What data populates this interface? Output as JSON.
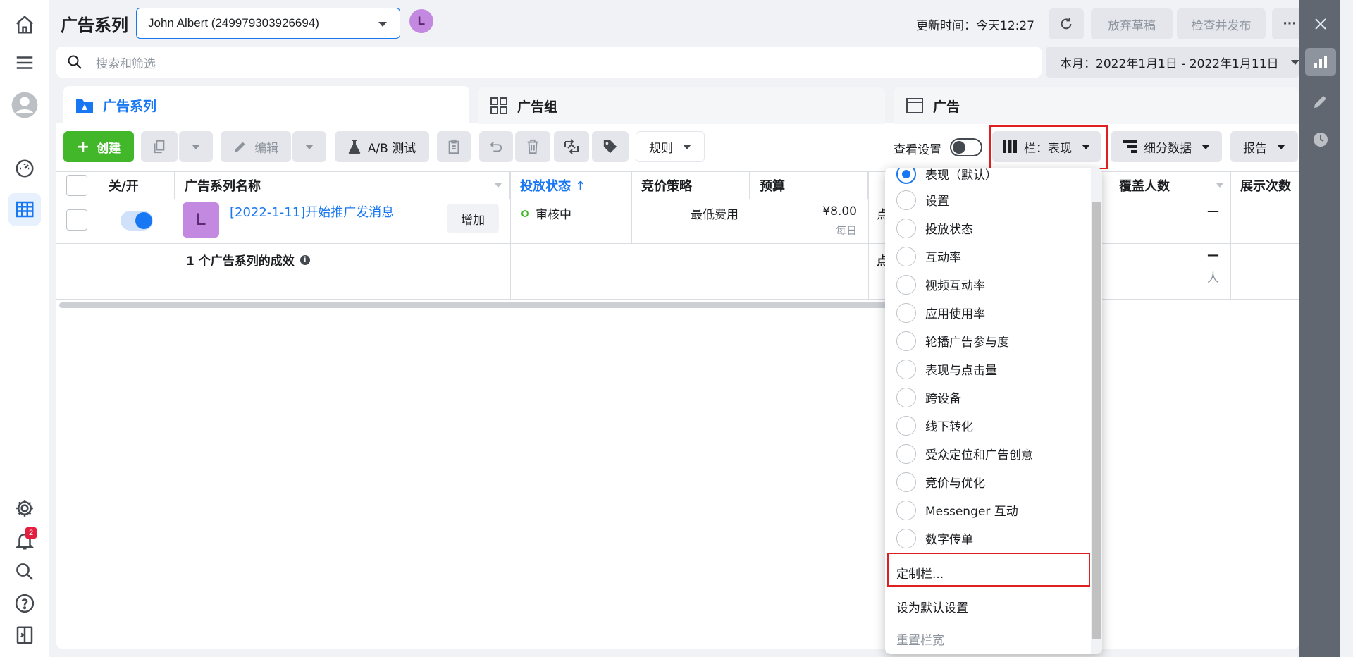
{
  "header": {
    "title": "广告系列",
    "account": "John Albert (249979303926694)",
    "avatar_letter": "L",
    "update_time": "更新时间：今天12:27",
    "discard_label": "放弃草稿",
    "publish_label": "检查并发布",
    "more_label": "···"
  },
  "search": {
    "placeholder": "搜索和筛选"
  },
  "date_range": "本月：2022年1月1日 - 2022年1月11日",
  "tabs": [
    {
      "label": "广告系列"
    },
    {
      "label": "广告组"
    },
    {
      "label": "广告"
    }
  ],
  "toolbar": {
    "create": "创建",
    "edit": "编辑",
    "ab_test": "A/B 测试",
    "rules": "规则",
    "view_settings": "查看设置",
    "columns": "栏：表现",
    "breakdown": "细分数据",
    "report": "报告"
  },
  "table": {
    "headers": {
      "onoff": "关/开",
      "name": "广告系列名称",
      "status": "投放状态 ↑",
      "bid": "竞价策略",
      "budget": "预算",
      "reach": "覆盖人数",
      "impressions": "展示次数"
    },
    "row": {
      "avatar_letter": "L",
      "name": "[2022-1-11]开始推广发消息",
      "add_label": "增加",
      "status": "审核中",
      "bid": "最低费用",
      "budget": "¥8.00",
      "budget_period": "每日",
      "partial": "点",
      "reach": "—"
    },
    "summary": {
      "label": "1 个广告系列的成效",
      "partial": "点",
      "reach": "—",
      "reach_unit": "人"
    }
  },
  "columns_menu": {
    "items": [
      {
        "label": "表现（默认）",
        "selected": true
      },
      {
        "label": "设置"
      },
      {
        "label": "投放状态"
      },
      {
        "label": "互动率"
      },
      {
        "label": "视频互动率"
      },
      {
        "label": "应用使用率"
      },
      {
        "label": "轮播广告参与度"
      },
      {
        "label": "表现与点击量"
      },
      {
        "label": "跨设备"
      },
      {
        "label": "线下转化"
      },
      {
        "label": "受众定位和广告创意"
      },
      {
        "label": "竞价与优化"
      },
      {
        "label": "Messenger 互动"
      },
      {
        "label": "数字传单"
      }
    ],
    "customize": "定制栏...",
    "set_default": "设为默认设置",
    "reset_width": "重置栏宽"
  },
  "notifications": {
    "count": "2"
  },
  "colors": {
    "accent": "#1877f2",
    "create": "#42b72a",
    "highlight": "#e02020"
  }
}
